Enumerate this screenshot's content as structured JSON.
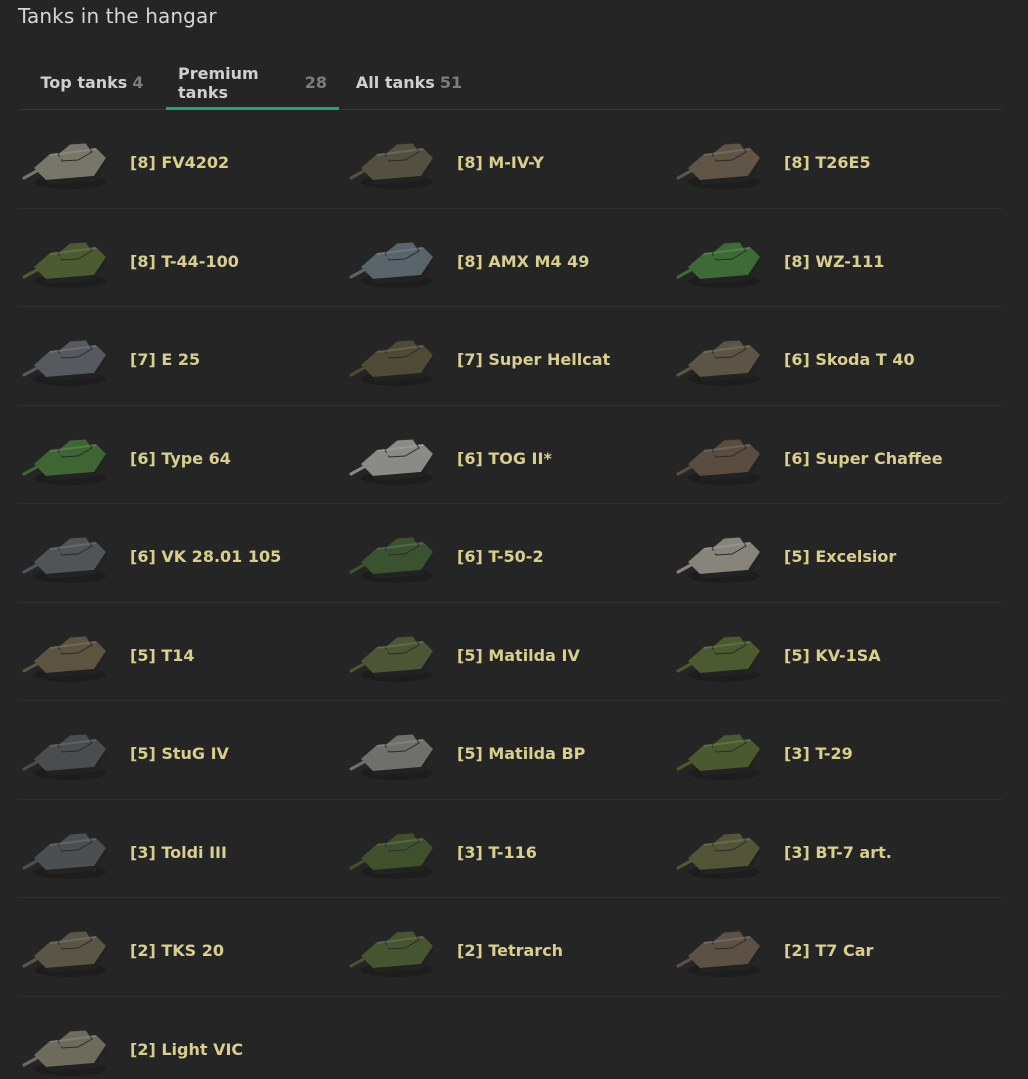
{
  "header": {
    "title": "Tanks in the hangar"
  },
  "tabs": [
    {
      "label": "Top tanks",
      "count": "4",
      "active": false
    },
    {
      "label": "Premium tanks",
      "count": "28",
      "active": true
    },
    {
      "label": "All tanks",
      "count": "51",
      "active": false
    }
  ],
  "tanks": [
    {
      "name": "[8] FV4202",
      "color": "#77766a"
    },
    {
      "name": "[8] M-IV-Y",
      "color": "#545041"
    },
    {
      "name": "[8] T26E5",
      "color": "#5f5446"
    },
    {
      "name": "[8] T-44-100",
      "color": "#4d5b33"
    },
    {
      "name": "[8] AMX M4 49",
      "color": "#58656b"
    },
    {
      "name": "[8] WZ-111",
      "color": "#3d6a36"
    },
    {
      "name": "[7] E 25",
      "color": "#565a5e"
    },
    {
      "name": "[7] Super Hellcat",
      "color": "#4e4a35"
    },
    {
      "name": "[6] Skoda T 40",
      "color": "#5c5444"
    },
    {
      "name": "[6] Type 64",
      "color": "#3f6533"
    },
    {
      "name": "[6] TOG II*",
      "color": "#8a8a86"
    },
    {
      "name": "[6] Super Chaffee",
      "color": "#5a4d40"
    },
    {
      "name": "[6] VK 28.01 105",
      "color": "#4f5457"
    },
    {
      "name": "[6] T-50-2",
      "color": "#3b5230"
    },
    {
      "name": "[5] Excelsior",
      "color": "#86847b"
    },
    {
      "name": "[5] T14",
      "color": "#5c5340"
    },
    {
      "name": "[5] Matilda IV",
      "color": "#4c5534"
    },
    {
      "name": "[5] KV-1SA",
      "color": "#4b5a2f"
    },
    {
      "name": "[5] StuG IV",
      "color": "#4a4c4e"
    },
    {
      "name": "[5] Matilda BP",
      "color": "#6f6f6c"
    },
    {
      "name": "[3] T-29",
      "color": "#4a5a2e"
    },
    {
      "name": "[3] Toldi III",
      "color": "#4b4f52"
    },
    {
      "name": "[3] T-116",
      "color": "#40502d"
    },
    {
      "name": "[3] BT-7 art.",
      "color": "#525537"
    },
    {
      "name": "[2] TKS 20",
      "color": "#5a5646"
    },
    {
      "name": "[2] Tetrarch",
      "color": "#46542f"
    },
    {
      "name": "[2] T7 Car",
      "color": "#5d5145"
    },
    {
      "name": "[2] Light VIC",
      "color": "#6d6b5c"
    }
  ]
}
